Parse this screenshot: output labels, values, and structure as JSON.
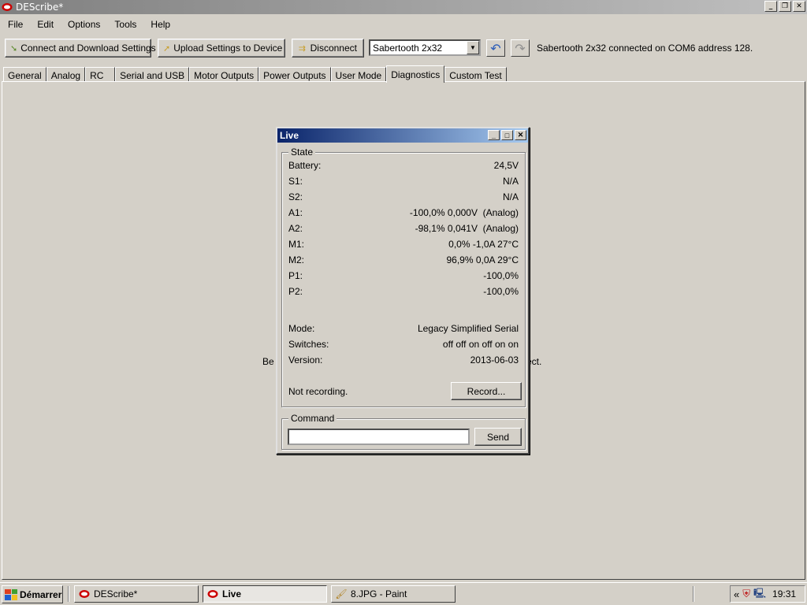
{
  "window": {
    "title": "DEScribe*"
  },
  "menu": [
    "File",
    "Edit",
    "Options",
    "Tools",
    "Help"
  ],
  "toolbar": {
    "connect_label": "Connect and Download Settings",
    "upload_label": "Upload Settings to Device",
    "disconnect_label": "Disconnect",
    "device_select": "Sabertooth 2x32",
    "status": "Sabertooth 2x32 connected on COM6 address 128."
  },
  "tabs": [
    "General",
    "Analog",
    "RC",
    "Serial and USB",
    "Motor Outputs",
    "Power Outputs",
    "User Mode",
    "Diagnostics",
    "Custom Test"
  ],
  "active_tab": "Diagnostics",
  "behind_text": {
    "left": "Be",
    "right": "ect."
  },
  "live": {
    "title": "Live",
    "state_legend": "State",
    "rows": [
      {
        "label": "Battery:",
        "value": "24,5V"
      },
      {
        "label": "S1:",
        "value": "N/A"
      },
      {
        "label": "S2:",
        "value": "N/A"
      },
      {
        "label": "A1:",
        "value": "-100,0% 0,000V  (Analog)"
      },
      {
        "label": "A2:",
        "value": "-98,1% 0,041V  (Analog)"
      },
      {
        "label": "M1:",
        "value": "0,0% -1,0A 27°C"
      },
      {
        "label": "M2:",
        "value": "96,9% 0,0A 29°C"
      },
      {
        "label": "P1:",
        "value": "-100,0%"
      },
      {
        "label": "P2:",
        "value": "-100,0%"
      }
    ],
    "info_rows": [
      {
        "label": "Mode:",
        "value": "Legacy Simplified Serial"
      },
      {
        "label": "Switches:",
        "value": "off off on off on on"
      },
      {
        "label": "Version:",
        "value": "2013-06-03"
      }
    ],
    "recording_status": "Not recording.",
    "record_button": "Record...",
    "command_legend": "Command",
    "command_value": "",
    "send_button": "Send"
  },
  "taskbar": {
    "start_label": "Démarrer",
    "tasks": [
      {
        "label": "DEScribe*",
        "active": false
      },
      {
        "label": "Live",
        "active": true
      },
      {
        "label": "8.JPG - Paint",
        "active": false
      }
    ],
    "clock": "19:31",
    "tray_expand": "«"
  }
}
